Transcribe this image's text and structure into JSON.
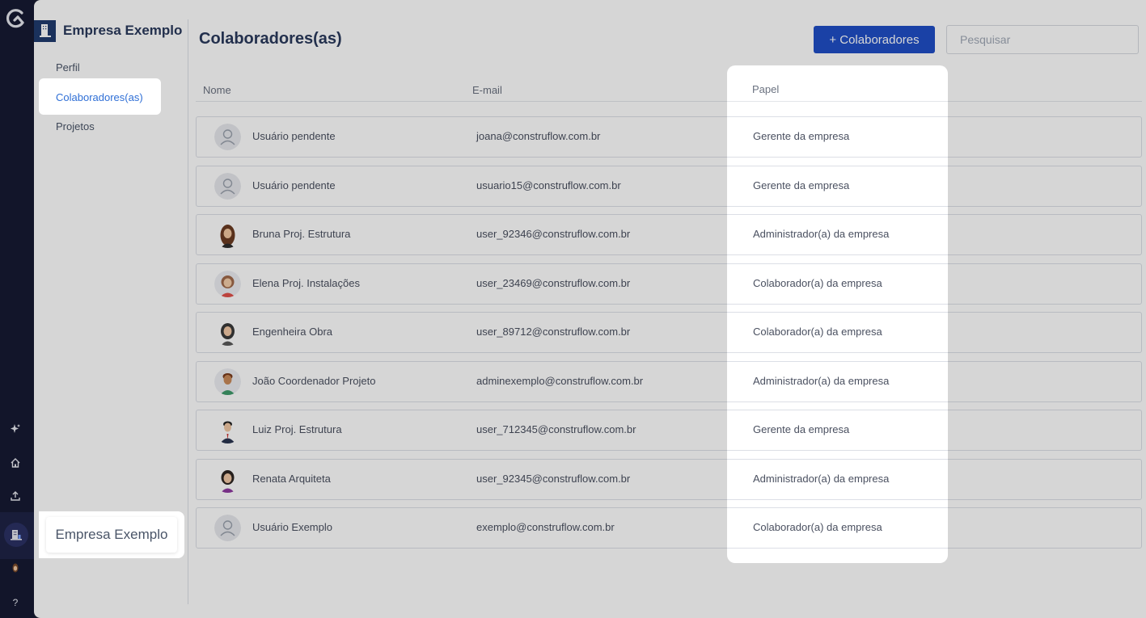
{
  "company": {
    "name": "Empresa Exemplo"
  },
  "sidebar": {
    "items": [
      {
        "label": "Perfil"
      },
      {
        "label": "Colaboradores(as)"
      },
      {
        "label": "Projetos"
      }
    ]
  },
  "header": {
    "title": "Colaboradores(as)",
    "add_button_label": "+ Colaboradores",
    "search_placeholder": "Pesquisar"
  },
  "table": {
    "columns": [
      "Nome",
      "E-mail",
      "Papel"
    ],
    "rows": [
      {
        "name": "Usuário pendente",
        "email": "joana@construflow.com.br",
        "role": "Gerente da empresa",
        "avatar": "placeholder"
      },
      {
        "name": "Usuário pendente",
        "email": "usuario15@construflow.com.br",
        "role": "Gerente da empresa",
        "avatar": "placeholder"
      },
      {
        "name": "Bruna Proj. Estrutura",
        "email": "user_92346@construflow.com.br",
        "role": "Administrador(a) da empresa",
        "avatar": "woman-brown-hair"
      },
      {
        "name": "Elena Proj. Instalações",
        "email": "user_23469@construflow.com.br",
        "role": "Colaborador(a) da empresa",
        "avatar": "woman-red"
      },
      {
        "name": "Engenheira Obra",
        "email": "user_89712@construflow.com.br",
        "role": "Colaborador(a) da empresa",
        "avatar": "woman-dark-hair"
      },
      {
        "name": "João Coordenador Projeto",
        "email": "adminexemplo@construflow.com.br",
        "role": "Administrador(a) da empresa",
        "avatar": "man-green"
      },
      {
        "name": "Luiz Proj. Estrutura",
        "email": "user_712345@construflow.com.br",
        "role": "Gerente da empresa",
        "avatar": "man-suit"
      },
      {
        "name": "Renata Arquiteta",
        "email": "user_92345@construflow.com.br",
        "role": "Administrador(a) da empresa",
        "avatar": "woman-purple"
      },
      {
        "name": "Usuário Exemplo",
        "email": "exemplo@construflow.com.br",
        "role": "Colaborador(a) da empresa",
        "avatar": "placeholder"
      }
    ]
  },
  "tooltip": {
    "label": "Empresa Exemplo"
  },
  "rail": {
    "icons": [
      "app-logo-icon",
      "sparkle-icon",
      "home-icon",
      "upload-icon",
      "company-icon",
      "profile-avatar",
      "help-icon"
    ],
    "help_label": "?"
  },
  "colors": {
    "accent": "#1f4ec6",
    "rail": "#161a33",
    "link": "#2f6fd6"
  }
}
